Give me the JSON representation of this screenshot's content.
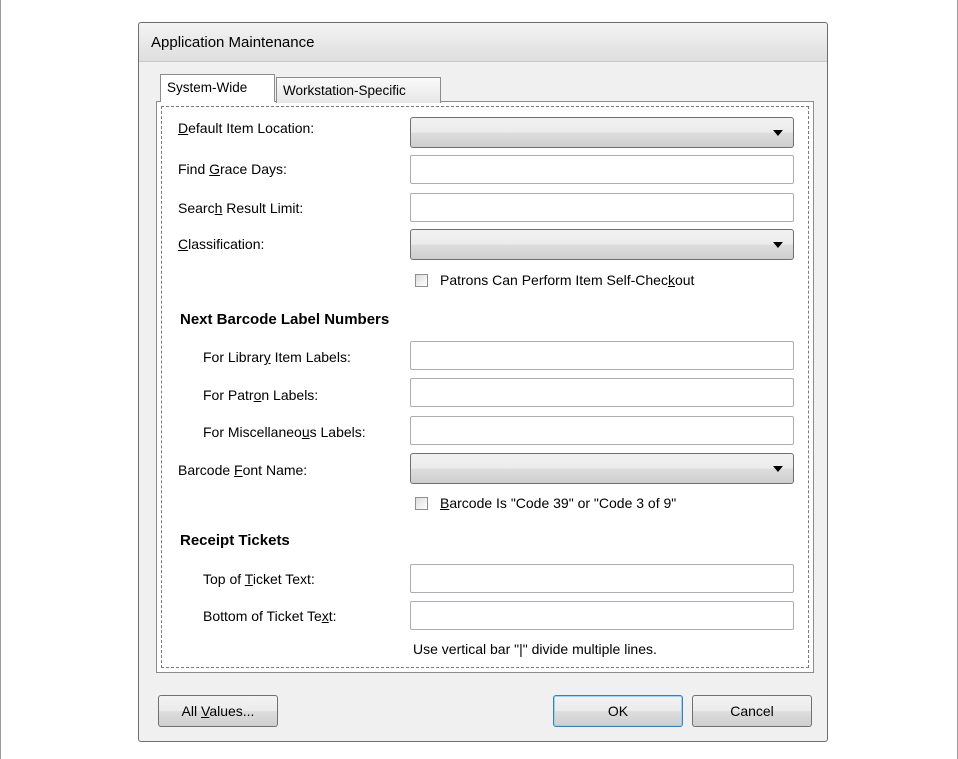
{
  "window": {
    "title": "Application Maintenance"
  },
  "tabs": [
    {
      "label": "System-Wide",
      "active": true
    },
    {
      "label": "Workstation-Specific",
      "active": false
    }
  ],
  "form": {
    "default_item_location": {
      "label_pre": "",
      "label_key": "D",
      "label_post": "efault Item Location:",
      "value": ""
    },
    "find_grace_days": {
      "label_pre": "Find ",
      "label_key": "G",
      "label_post": "race Days:",
      "value": ""
    },
    "search_result_limit": {
      "label_pre": "Searc",
      "label_key": "h",
      "label_post": " Result Limit:",
      "value": ""
    },
    "classification": {
      "label_pre": "",
      "label_key": "C",
      "label_post": "lassification:",
      "value": ""
    },
    "self_checkout": {
      "label_pre": "Patrons Can Perform Item Self-Chec",
      "label_key": "k",
      "label_post": "out",
      "checked": false
    },
    "barcode_section": {
      "heading": "Next Barcode Label Numbers"
    },
    "library_item_labels": {
      "label_pre": "For Librar",
      "label_key": "y",
      "label_post": " Item Labels:",
      "value": ""
    },
    "patron_labels": {
      "label_pre": "For Patr",
      "label_key": "o",
      "label_post": "n Labels:",
      "value": ""
    },
    "misc_labels": {
      "label_pre": "For Miscellaneo",
      "label_key": "u",
      "label_post": "s Labels:",
      "value": ""
    },
    "barcode_font_name": {
      "label_pre": "Barcode ",
      "label_key": "F",
      "label_post": "ont Name:",
      "value": ""
    },
    "code39": {
      "label_pre": "",
      "label_key": "B",
      "label_post": "arcode Is \"Code 39\" or \"Code 3 of 9\"",
      "checked": false
    },
    "receipt_section": {
      "heading": "Receipt Tickets"
    },
    "top_ticket_text": {
      "label_pre": "Top of ",
      "label_key": "T",
      "label_post": "icket Text:",
      "value": ""
    },
    "bottom_ticket_text": {
      "label_pre": "Bottom of Ticket Te",
      "label_key": "x",
      "label_post": "t:",
      "value": ""
    },
    "ticket_note": "Use vertical bar \"|\" divide multiple lines."
  },
  "buttons": {
    "all_values": {
      "label_pre": "All ",
      "label_key": "V",
      "label_post": "alues..."
    },
    "ok": "OK",
    "cancel": "Cancel"
  },
  "colors": {
    "window_bg": "#f0f0f0",
    "panel_bg": "#ffffff",
    "default_button_border": "#3c7fb1"
  },
  "icons": [
    "dropdown-arrow-icon",
    "checkbox-icon"
  ]
}
